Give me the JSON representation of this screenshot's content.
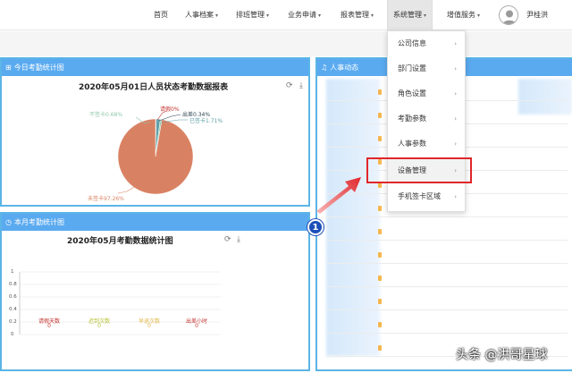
{
  "nav": {
    "items": [
      {
        "label": "首页",
        "caret": false
      },
      {
        "label": "人事档案",
        "caret": true
      },
      {
        "label": "排班管理",
        "caret": true
      },
      {
        "label": "业务申请",
        "caret": true
      },
      {
        "label": "报表管理",
        "caret": true
      },
      {
        "label": "系统管理",
        "caret": true
      },
      {
        "label": "增值服务",
        "caret": true
      }
    ],
    "username": "尹桂洪"
  },
  "today_panel": {
    "header": "今日考勤统计图",
    "title": "2020年05月01日人员状态考勤数据报表"
  },
  "month_panel": {
    "header": "本月考勤统计图",
    "title": "2020年05月考勤数据统计图"
  },
  "news_panel": {
    "header": "人事动态"
  },
  "dropdown": {
    "items": [
      "公司信息",
      "部门设置",
      "角色设置",
      "考勤参数",
      "人事参数",
      "设备管理",
      "手机签卡区域"
    ],
    "selected": "设备管理",
    "arrow": "›"
  },
  "annotation": {
    "badge": "1",
    "accent": "#e0262b"
  },
  "watermark": "头条 @洪哥星球",
  "chart_data": [
    {
      "type": "pie",
      "title": "2020年05月01日人员状态考勤数据报表",
      "slices": [
        {
          "label": "未签卡",
          "value": 97.26,
          "text": "未签卡97.26%",
          "color": "#d98263"
        },
        {
          "label": "请假",
          "value": 0,
          "text": "请假0%",
          "color": "#c23531"
        },
        {
          "label": "出差",
          "value": 0.34,
          "text": "出差0.34%",
          "color": "#2f4554"
        },
        {
          "label": "已签卡",
          "value": 1.71,
          "text": "已签卡1.71%",
          "color": "#61a0a8"
        },
        {
          "label": "不签卡",
          "value": 0.68,
          "text": "不签卡0.68%",
          "color": "#91c7ae"
        }
      ]
    },
    {
      "type": "bar",
      "title": "2020年05月考勤数据统计图",
      "categories": [
        "请假天数",
        "迟到次数",
        "早退次数",
        "出差小时"
      ],
      "category_colors": [
        "#c23531",
        "#b6c334",
        "#e0b84c",
        "#c23531"
      ],
      "values": [
        0,
        0,
        0,
        0
      ],
      "yticks": [
        "1",
        "0.8",
        "0.6",
        "0.4",
        "0.2",
        "0"
      ],
      "ylim": [
        0,
        1
      ]
    }
  ]
}
